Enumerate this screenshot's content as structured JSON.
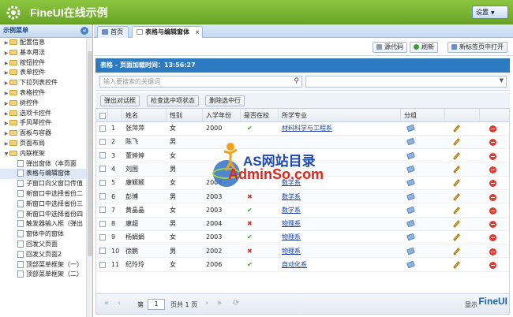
{
  "header": {
    "title": "FineUI在线示例",
    "settings_label": "设置"
  },
  "sidebar": {
    "title": "示例菜单",
    "items": [
      {
        "label": "配置信息",
        "level": 0,
        "type": "folder"
      },
      {
        "label": "基本用法",
        "level": 0,
        "type": "folder"
      },
      {
        "label": "按钮控件",
        "level": 0,
        "type": "folder"
      },
      {
        "label": "表单控件",
        "level": 0,
        "type": "folder"
      },
      {
        "label": "下拉列表控件",
        "level": 0,
        "type": "folder"
      },
      {
        "label": "表格控件",
        "level": 0,
        "type": "folder"
      },
      {
        "label": "树控件",
        "level": 0,
        "type": "folder"
      },
      {
        "label": "选项卡控件",
        "level": 0,
        "type": "folder"
      },
      {
        "label": "手风琴控件",
        "level": 0,
        "type": "folder"
      },
      {
        "label": "面板与容器",
        "level": 0,
        "type": "folder"
      },
      {
        "label": "页面布局",
        "level": 0,
        "type": "folder"
      },
      {
        "label": "内联框架",
        "level": 0,
        "type": "folder",
        "expanded": true
      },
      {
        "label": "弹出窗体（本页面",
        "level": 1,
        "type": "page"
      },
      {
        "label": "表格与编辑窗体",
        "level": 1,
        "type": "page",
        "selected": true
      },
      {
        "label": "子窗口向父窗口传值",
        "level": 1,
        "type": "page"
      },
      {
        "label": "新窗口中选择省份二",
        "level": 1,
        "type": "page"
      },
      {
        "label": "新窗口中选择省份三",
        "level": 1,
        "type": "page"
      },
      {
        "label": "新窗口中选择省份四",
        "level": 1,
        "type": "page"
      },
      {
        "label": "触发器输入框（弹出",
        "level": 1,
        "type": "page"
      },
      {
        "label": "窗体中的窗体",
        "level": 1,
        "type": "page"
      },
      {
        "label": "回发父页面",
        "level": 1,
        "type": "page"
      },
      {
        "label": "回发父页面2",
        "level": 1,
        "type": "page"
      },
      {
        "label": "顶部菜单框架（一）",
        "level": 1,
        "type": "page"
      },
      {
        "label": "顶部菜单框架（二）",
        "level": 1,
        "type": "page"
      }
    ]
  },
  "tabs": [
    {
      "label": "首页"
    },
    {
      "label": "表格与编辑窗体",
      "active": true
    }
  ],
  "toolbar": {
    "source_label": "源代码",
    "refresh_label": "刷新",
    "newtab_label": "新标签页中打开"
  },
  "panel": {
    "title": "表格 - 页面加载时间：13:56:27",
    "search_placeholder": "输入要搜索的关键词"
  },
  "actions": {
    "popup_label": "弹出对话框",
    "check_label": "检查选中项状态",
    "delete_label": "删除选中行"
  },
  "grid": {
    "columns": [
      "姓名",
      "性别",
      "入学年份",
      "是否在校",
      "所学专业",
      "分组"
    ],
    "rows": [
      {
        "n": "1",
        "name": "张萍萍",
        "gender": "女",
        "year": "2000",
        "inschool": true,
        "major": "材料科学与工程系"
      },
      {
        "n": "2",
        "name": "陈飞",
        "gender": "男",
        "year": "",
        "inschool": null,
        "major": ""
      },
      {
        "n": "3",
        "name": "董婷婷",
        "gender": "女",
        "year": "",
        "inschool": null,
        "major": ""
      },
      {
        "n": "4",
        "name": "刘国",
        "gender": "男",
        "year": "",
        "inschool": null,
        "major": ""
      },
      {
        "n": "5",
        "name": "康颖颖",
        "gender": "女",
        "year": "2008",
        "inschool": null,
        "major": "数学系"
      },
      {
        "n": "6",
        "name": "彭博",
        "gender": "男",
        "year": "2003",
        "inschool": false,
        "major": "数学系"
      },
      {
        "n": "7",
        "name": "黄晶晶",
        "gender": "女",
        "year": "2003",
        "inschool": true,
        "major": "数学系"
      },
      {
        "n": "8",
        "name": "康超",
        "gender": "男",
        "year": "2004",
        "inschool": false,
        "major": "物理系"
      },
      {
        "n": "9",
        "name": "杨娟娟",
        "gender": "女",
        "year": "2003",
        "inschool": true,
        "major": "物理系"
      },
      {
        "n": "10",
        "name": "徐鹏",
        "gender": "男",
        "year": "2002",
        "inschool": false,
        "major": "物理系"
      },
      {
        "n": "11",
        "name": "纪玲玲",
        "gender": "女",
        "year": "2006",
        "inschool": true,
        "major": "自动化系"
      }
    ]
  },
  "pager": {
    "page_prefix": "第",
    "page_value": "1",
    "page_suffix": "页共 1 页",
    "right_text": "显示"
  },
  "watermark": {
    "line1": "AS网站目录",
    "line2": "AdminSo.com"
  },
  "badge": "FineUI",
  "colors": {
    "header_green": "#7ab535",
    "panel_blue": "#2c7bc1",
    "ok": "#2fa533",
    "no": "#d93025"
  }
}
